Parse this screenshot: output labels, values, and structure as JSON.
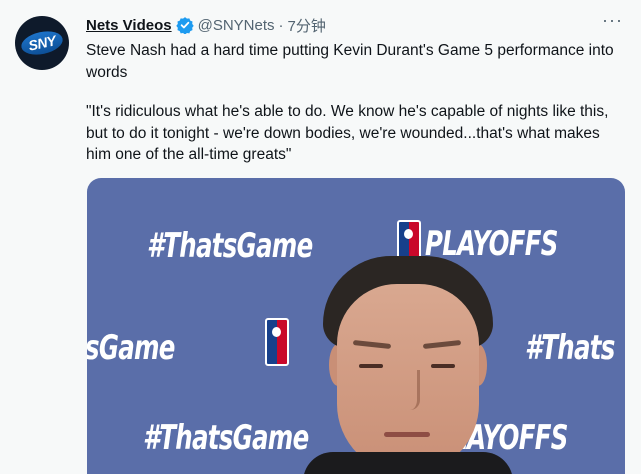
{
  "tweet": {
    "author_name": "Nets Videos",
    "handle": "@SNYNets",
    "separator": "·",
    "time": "7分钟",
    "more_label": "···",
    "avatar_logo_text": "SNY",
    "paragraph_1": "Steve Nash had a hard time putting Kevin Durant's Game 5 performance into words",
    "paragraph_2": "\"It's ridiculous what he's able to do. We know he's capable of nights like this, but to do it tonight - we're down bodies, we're wounded...that's what makes him one of the all-time greats\""
  },
  "media": {
    "backdrop_text_1": "#ThatsGame",
    "backdrop_text_2": "PLAYOFFS",
    "backdrop_text_3": "sGame",
    "backdrop_text_4": "#Thats",
    "backdrop_text_5": "#ThatsGame",
    "backdrop_text_6": "PLAYOFFS"
  },
  "colors": {
    "background": "#f7f9f9",
    "verified_blue": "#1d9bf0",
    "backdrop": "#5a6ea9"
  },
  "icons": {
    "verified": "verified-badge-icon",
    "more": "more-options-icon"
  }
}
